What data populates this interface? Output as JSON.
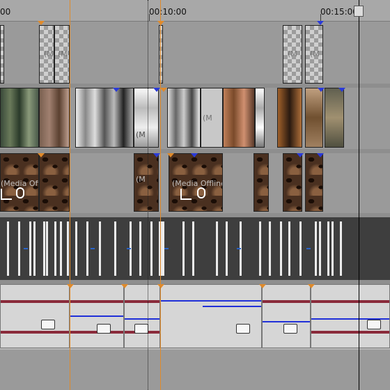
{
  "ruler": {
    "timecodes": [
      {
        "label": "00",
        "id": "0"
      },
      {
        "label": "00:10:00",
        "id": "1"
      },
      {
        "label": "00:15:00",
        "id": "2"
      }
    ]
  },
  "tracks": {
    "clip_text": "(Media Offline)",
    "offline_short": "(M",
    "offline_mid": "(Media Offl"
  },
  "colors": {
    "clip_border": "#222222",
    "marker_orange": "#e08a2a",
    "marker_blue": "#2a3ad8",
    "envelope_blue": "#2030d8",
    "waveform": "#8a2a3a",
    "audio_track_bg": "#d6d6d6",
    "dark_track_bg": "#3e3e3e",
    "playhead": "#000000"
  },
  "icons": [
    "crop-icon",
    "pan-crop-icon",
    "playhead-handle-icon",
    "pan-knob-icon"
  ]
}
